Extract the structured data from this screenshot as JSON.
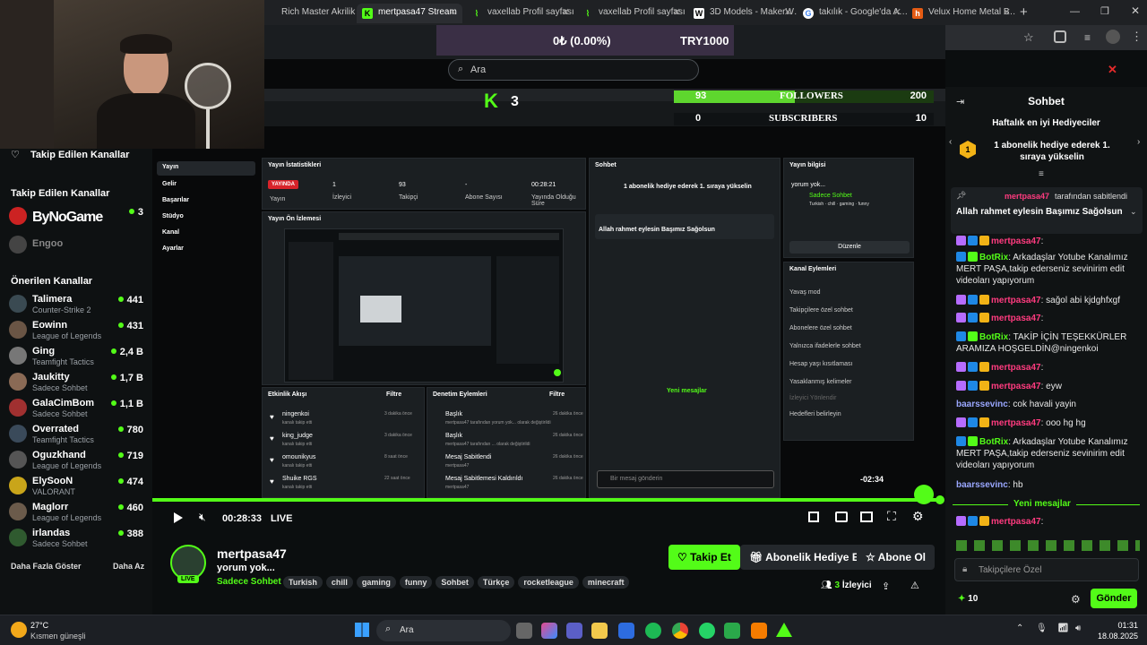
{
  "browser": {
    "tabs": [
      {
        "label": "Rich Master Akrilik B…",
        "active": false
      },
      {
        "label": "mertpasa47 Stream",
        "active": true
      },
      {
        "label": "vaxellab Profil sayfası",
        "active": false
      },
      {
        "label": "vaxellab Profil sayfası",
        "active": false
      },
      {
        "label": "3D Models - MakerW…",
        "active": false
      },
      {
        "label": "takılık - Google'da A…",
        "active": false
      },
      {
        "label": "Velux Home Metal B…",
        "active": false
      }
    ],
    "new_tab": "+"
  },
  "overlay": {
    "balance": "0₺ (0.00%)",
    "goal": "TRY1000",
    "search_placeholder": "Ara",
    "kick_count": "3",
    "followers_label": "FOLLOWERS",
    "followers_left": "93",
    "followers_right": "200",
    "subscribers_label": "SUBSCRIBERS",
    "subscribers_left": "0",
    "subscribers_right": "10"
  },
  "sidebar": {
    "followed_header": "Takip Edilen Kanallar",
    "followed_header2": "Takip Edilen Kanallar",
    "followed": [
      {
        "name": "ByNoGame",
        "viewers": "3"
      },
      {
        "name": "Engoo",
        "viewers": ""
      }
    ],
    "recommended_header": "Önerilen Kanallar",
    "recommended": [
      {
        "name": "Talimera",
        "game": "Counter-Strike 2",
        "viewers": "441"
      },
      {
        "name": "Eowinn",
        "game": "League of Legends",
        "viewers": "431"
      },
      {
        "name": "Ging",
        "game": "Teamfight Tactics",
        "viewers": "2,4 B"
      },
      {
        "name": "Jaukitty",
        "game": "Sadece Sohbet",
        "viewers": "1,7 B"
      },
      {
        "name": "GalaCimBom",
        "game": "Sadece Sohbet",
        "viewers": "1,1 B"
      },
      {
        "name": "Overrated",
        "game": "Teamfight Tactics",
        "viewers": "780"
      },
      {
        "name": "Oguzkhand",
        "game": "League of Legends",
        "viewers": "719"
      },
      {
        "name": "ElySooN",
        "game": "VALORANT",
        "viewers": "474"
      },
      {
        "name": "Maglorr",
        "game": "League of Legends",
        "viewers": "460"
      },
      {
        "name": "irlandas",
        "game": "Sadece Sohbet",
        "viewers": "388"
      }
    ],
    "show_more": "Daha Fazla Göster",
    "show_less": "Daha Az"
  },
  "dashboard": {
    "nav": [
      "Yayın",
      "Gelir",
      "Başarılar",
      "Stüdyo",
      "Kanal",
      "Ayarlar"
    ],
    "stats_title": "Yayın İstatistikleri",
    "live_badge": "YAYINDA",
    "stats": [
      {
        "value": "1",
        "label": "İzleyici"
      },
      {
        "value": "93",
        "label": "Takipçi"
      },
      {
        "value": "-",
        "label": "Abone Sayısı"
      },
      {
        "value": "00:28:21",
        "label": "Yayında Olduğu Süre"
      }
    ],
    "stats_sub": "Yayın",
    "preview_title": "Yayın Ön İzlemesi",
    "activity_title": "Etkinlik Akışı",
    "filter": "Filtre",
    "activity": [
      {
        "name": "ningenkoi",
        "sub": "kanalı takip etti",
        "time": "3 dakika önce"
      },
      {
        "name": "king_judge",
        "sub": "kanalı takip etti",
        "time": "3 dakika önce"
      },
      {
        "name": "omounikyus",
        "sub": "kanalı takip etti",
        "time": "8 saat önce"
      },
      {
        "name": "Shuike RGS",
        "sub": "kanalı takip etti",
        "time": "22 saat önce"
      }
    ],
    "mod_title": "Denetim Eylemleri",
    "mod": [
      {
        "name": "Başlık",
        "sub": "mertpasa47 tarafından yorum yok... olarak değiştirildi",
        "time": "26 dakika önce"
      },
      {
        "name": "Başlık",
        "sub": "mertpasa47 tarafından ... olarak değiştirildi",
        "time": "26 dakika önce"
      },
      {
        "name": "Mesaj Sabitlendi",
        "sub": "mertpasa47",
        "time": "26 dakika önce"
      },
      {
        "name": "Mesaj Sabitlemesi Kaldırıldı",
        "sub": "mertpasa47",
        "time": "26 dakika önce"
      }
    ],
    "chat_title": "Sohbet",
    "chat_gift": "1 abonelik hediye ederek 1. sıraya yükselin",
    "chat_pinned": "Allah rahmet eylesin Başımız Sağolsun",
    "new_messages": "Yeni mesajlar",
    "chat_placeholder": "Bir mesaj gönderin",
    "info_title": "Yayın bilgisi",
    "info_text": "yorum yok...",
    "info_cat": "Sadece Sohbet",
    "info_tags": [
      "Turkish",
      "chill",
      "gaming",
      "funny"
    ],
    "edit": "Düzenle",
    "channel_actions_title": "Kanal Eylemleri",
    "channel_actions": [
      "Yavaş mod",
      "Takipçilere özel sohbet",
      "Abonelere özel sohbet",
      "Yalnızca ifadelerle sohbet",
      "Hesap yaşı kısıtlaması",
      "Yasaklanmış kelimeler",
      "İzleyici Yönlendir",
      "Hedefleri belirleyin"
    ],
    "countdown": "-02:34"
  },
  "player": {
    "time": "00:28:33",
    "live": "LIVE"
  },
  "stream_info": {
    "channel": "mertpasa47",
    "title": "yorum yok...",
    "category": "Sadece Sohbet",
    "tags": [
      "Turkish",
      "chill",
      "gaming",
      "funny",
      "Sohbet",
      "Türkçe",
      "rocketleague",
      "minecraft"
    ],
    "live_badge": "LIVE",
    "follow": "Takip Et",
    "gift": "Abonelik Hediye Et",
    "subscribe": "Abone Ol",
    "viewers_count": "3",
    "viewers_label": "İzleyici"
  },
  "chat": {
    "title": "Sohbet",
    "top_gifters": "Haftalık en iyi Hediyeciler",
    "gift_prompt": "1 abonelik hediye ederek 1. sıraya yükselin",
    "pinned_by": "mertpasa47",
    "pinned_suffix": "tarafından sabitlendi",
    "pinned_text": "Allah rahmet eylesin Başımız Sağolsun",
    "messages": [
      {
        "user": "mertpasa47",
        "text": ":",
        "color": "#ff3b7f"
      },
      {
        "user": "BotRix",
        "text": ": Arkadaşlar Yotube Kanalımız MERT PAŞA,takip ederseniz sevinirim edit videoları yapıyorum",
        "color": "#53fc18"
      },
      {
        "user": "mertpasa47",
        "text": ": sağol abi kjdghfxgf",
        "color": "#ff3b7f"
      },
      {
        "user": "mertpasa47",
        "text": ":",
        "color": "#ff3b7f"
      },
      {
        "user": "BotRix",
        "text": ": TAKİP İÇİN TEŞEKKÜRLER ARAMIZA HOŞGELDİN@ningenkoi",
        "color": "#53fc18"
      },
      {
        "user": "mertpasa47",
        "text": ":",
        "color": "#ff3b7f"
      },
      {
        "user": "mertpasa47",
        "text": ": eyw",
        "color": "#ff3b7f"
      },
      {
        "user": "baarssevinc",
        "text": ": cok havali yayin",
        "color": "#9aa7ff"
      },
      {
        "user": "mertpasa47",
        "text": ": ooo hg hg",
        "color": "#ff3b7f"
      },
      {
        "user": "BotRix",
        "text": ": Arkadaşlar Yotube Kanalımız MERT PAŞA,takip ederseniz sevinirim edit videoları yapıyorum",
        "color": "#53fc18"
      },
      {
        "user": "baarssevinc",
        "text": ": hb",
        "color": "#9aa7ff"
      }
    ],
    "new_messages": "Yeni mesajlar",
    "last_user": "mertpasa47",
    "last_text": ":",
    "input_placeholder": "Takipçilere Özel",
    "points": "10",
    "send": "Gönder"
  },
  "taskbar": {
    "weather_temp": "27°C",
    "weather_desc": "Kısmen güneşli",
    "search": "Ara",
    "time": "01:31",
    "date": "18.08.2025"
  },
  "colors": {
    "kick_green": "#53fc18",
    "username_pink": "#ff3b7f",
    "background": "#0b0e0f"
  }
}
